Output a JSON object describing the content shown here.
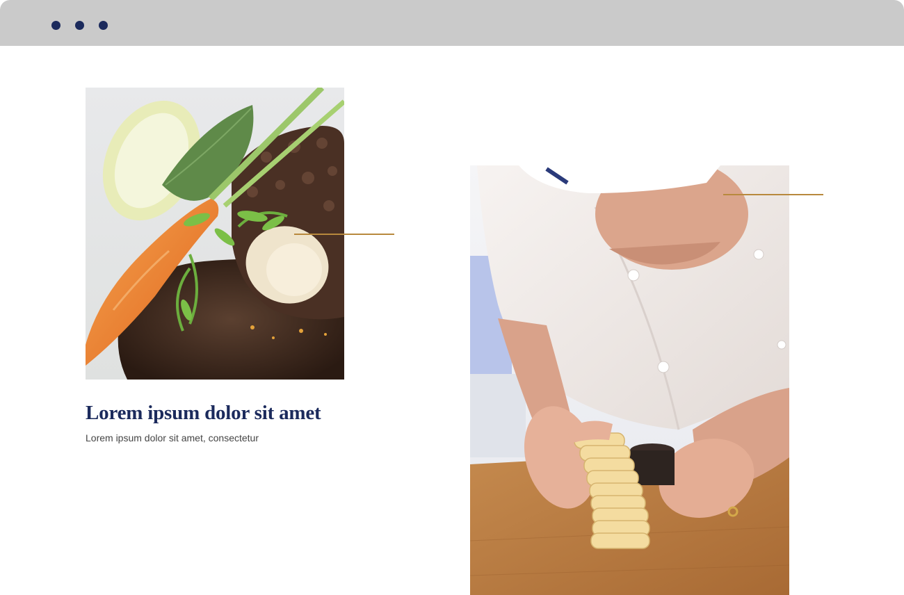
{
  "window": {
    "controls": [
      "dot",
      "dot",
      "dot"
    ]
  },
  "colors": {
    "titlebar": "#cacaca",
    "dots": "#1b2a5c",
    "accent": "#b8893d",
    "title": "#1b2a5c",
    "subtitle": "#444444"
  },
  "card": {
    "title": "Lorem ipsum dolor sit amet",
    "subtitle": "Lorem ipsum dolor sit amet, consectetur"
  },
  "images": {
    "food": "food-photo",
    "chef": "chef-photo"
  }
}
